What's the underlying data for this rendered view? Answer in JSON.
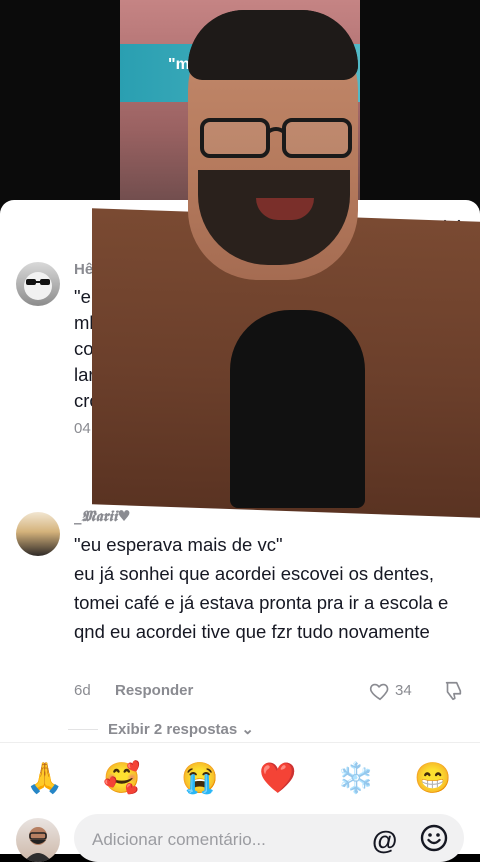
{
  "video": {
    "sign_text": "\"mint\nbank"
  },
  "sheet": {
    "title": "5.090",
    "close_icon": "close-icon"
  },
  "comments": [
    {
      "author": "Hêlo ❄️",
      "text_lines": [
        "\"eu espe",
        "mb",
        "co",
        "lar",
        "cro"
      ],
      "meta": "04"
    },
    {
      "author": "_𝕸𝖆𝖗𝖎𝖎♥",
      "text": "\"eu esperava mais de vc\"\neu já sonhei que acordei escovei os dentes, tomei café e já estava pronta pra ir a escola e qnd eu acordei tive que fzr tudo novamente",
      "age": "6d",
      "reply_label": "Responder",
      "likes": "34"
    }
  ],
  "replies_toggle": "Exibir 2 respostas ⌄",
  "emoji_bar": [
    "🙏",
    "🥰",
    "😭",
    "❤️",
    "❄️",
    "😁"
  ],
  "input": {
    "placeholder": "Adicionar comentário...",
    "at": "@"
  },
  "colors": {
    "muted": "#8a8b91",
    "text": "#161823",
    "heart_red": "#fe2c55"
  }
}
